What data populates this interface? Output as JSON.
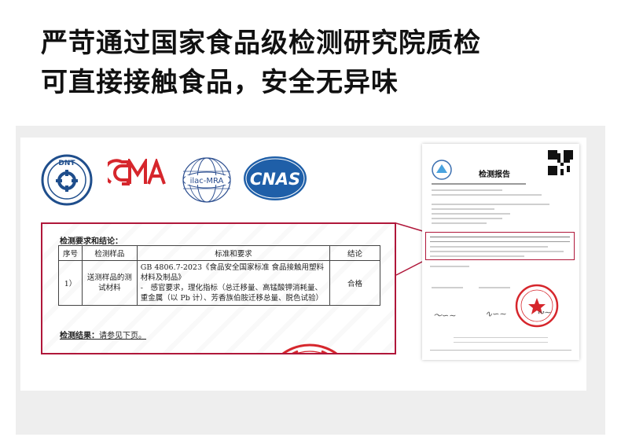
{
  "headline": {
    "line1": "严苛通过国家食品级检测研究院质检",
    "line2": "可直接接触食品，安全无异味"
  },
  "logos": [
    {
      "name": "dnt-logo",
      "text": "DNT"
    },
    {
      "name": "cma-logo",
      "text": "CMA"
    },
    {
      "name": "ilac-mra-logo",
      "text": "ilac-MRA"
    },
    {
      "name": "cnas-logo",
      "text": "CNAS"
    }
  ],
  "excerpt": {
    "section_title": "检测要求和结论：",
    "headers": [
      "序号",
      "检测样品",
      "标准和要求",
      "结论"
    ],
    "row": {
      "index": "1）",
      "sample": "送测样品的测试材料",
      "standard_line1": "GB 4806.7-2023《食品安全国家标准 食品接触用塑料材料及制品》",
      "standard_line2": "-　感官要求，理化指标（总迁移量、高锰酸钾消耗量、重金属（以 Pb 计）、芳香族伯胺迁移总量、脱色试验）",
      "conclusion": "合格"
    },
    "result_label": "检测结果：",
    "result_text": "请参见下页。"
  },
  "report": {
    "title": "检测报告"
  },
  "colors": {
    "accent": "#b0173a",
    "panel": "#eeeeee",
    "cnas_blue": "#1f5fa8",
    "cma_red": "#d6262c"
  }
}
